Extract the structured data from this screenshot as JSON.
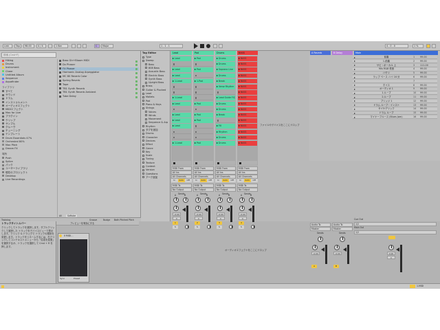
{
  "transport": {
    "link": "Link",
    "tap": "Tap",
    "tempo": "98.00",
    "signature": "4 / 4",
    "quantize": "1 Bar",
    "key": "C",
    "scale": "Major",
    "position": "1 . 1 . 1",
    "loop_end": "4 . 0 . 0",
    "cpu": "1 %"
  },
  "browser": {
    "search_placeholder": "検索 (Cmd+F)",
    "collections": [
      "Hiking",
      "Drums",
      "Instrument",
      "Cheer",
      "Untitled Album",
      "Sequence",
      "Aquafinder"
    ],
    "library_header": "ライブラリ",
    "library": [
      "すべて",
      "サウンド",
      "ドラム",
      "インストゥルメント",
      "オーディオエフェクト",
      "MIDIエフェクト",
      "Max for Live",
      "プラグイン",
      "クリップ",
      "サンプル",
      "グルーヴ",
      "チューニング",
      "テンプレート"
    ],
    "packs": [
      "Drum Essentials 47%",
      "Orchestral 80%",
      "Max Pitch",
      "Dream FX"
    ],
    "places_header": "場所",
    "places": [
      "Push",
      "Splice",
      "パック",
      "ユーザーライブラリ",
      "現在のプロジェクト",
      "Desktop",
      "Live Recordings"
    ],
    "files": [
      "Bass Gtr+Bloom MIDI",
      "Dx Phaser",
      "FX Phaser",
      "Harmonic Analog Arpeggiator",
      "MC 80 Reverb Color",
      "Spring Reverb",
      "Tape",
      "TB1 Synth Reverb",
      "TB1 Synth Reverb Ambient",
      "Tube Delay"
    ],
    "filter_label": "All",
    "filter_value": "Softube",
    "preview_label": "1 項目を選択",
    "preview_hint": "プレビューを有効にする"
  },
  "tag_editor": {
    "title": "Tag Editor",
    "tags": [
      "Type",
      "Sweep",
      "Bass",
      "808 Bass",
      "Acoustic Bass",
      "Electric Bass",
      "Synth Bass",
      "Upright Bass",
      "Brass",
      "Guitar & Plucked",
      "Lead",
      "Mallets",
      "Pad",
      "Piano & Keys",
      "Strings",
      "Voices",
      "Winds",
      "Movement",
      "Sequence & Arp",
      "Rhythm",
      "タグを追加",
      "Drums",
      "Character",
      "Devices",
      "Effect",
      "Genre",
      "Key",
      "Scale",
      "Tuning",
      "Texture",
      "Context",
      "Version",
      "Questions",
      "アーク追加"
    ]
  },
  "tracks": [
    {
      "name": "Lead",
      "color": "#59d9a8",
      "clips": [
        "Lead",
        "",
        "Lead",
        "Lead",
        "1-Lead",
        "",
        "",
        "1-Lead",
        "Lead",
        "",
        "Lead",
        "Lead",
        "Lead",
        "",
        "",
        "1-Lead"
      ],
      "input": "MIDI From",
      "input_src": "All Ins",
      "channel": "All Channels",
      "monitor_in": "In",
      "monitor_auto": "Auto",
      "monitor_off": "Off",
      "output": "MIDI To",
      "output_dst": "No Output",
      "send_label": "Sends",
      "send_a": "A",
      "send_b": "B",
      "vol": "-0.00",
      "pan": "C",
      "num": "1",
      "solo": "S"
    },
    {
      "name": "Pad",
      "color": "#59d9a8",
      "clips": [
        "Pad",
        "",
        "Pad",
        "",
        "1-Pad",
        "",
        "",
        "",
        "Pad",
        "",
        "Pad",
        "Pad",
        "",
        "",
        "",
        "Pad"
      ],
      "input": "MIDI From",
      "input_src": "All Ins",
      "channel": "All Channels",
      "monitor_in": "In",
      "monitor_auto": "Auto",
      "monitor_off": "Off",
      "output": "MIDI To",
      "output_dst": "No Output",
      "send_label": "Sends",
      "send_a": "A",
      "send_b": "B",
      "vol": "-0.00",
      "pan": "C",
      "num": "2",
      "solo": "S"
    },
    {
      "name": "Drums",
      "color": "#59d9a8",
      "clips": [
        "Drums",
        "Drums",
        "Soprano Line",
        "Drums",
        "Break",
        "Verse Rhythm",
        "",
        "Lead Guide FX2",
        "Drums",
        "Drums",
        "Break",
        "",
        "Fill",
        "Rhythm",
        "Drums",
        "Drums"
      ],
      "input": "MIDI From",
      "input_src": "All Ins",
      "channel": "All Channels",
      "monitor_in": "In",
      "monitor_auto": "Auto",
      "monitor_off": "Off",
      "output": "MIDI To",
      "output_dst": "No Output",
      "send_label": "Sends",
      "send_a": "A",
      "send_b": "B",
      "vol": "-0.00",
      "pan": "C",
      "num": "3",
      "solo": "S"
    },
    {
      "name": "BASS",
      "color": "#ea3f3f",
      "clips": [
        "BASS",
        "BASS",
        "BASS",
        "BASS",
        "BASS",
        "BASS",
        "BASS",
        "BASS",
        "BASS",
        "BASS",
        "BASS",
        "BASS",
        "BASS",
        "BASS",
        "BASS",
        "BASS"
      ],
      "input": "MIDI From",
      "input_src": "All Ins",
      "channel": "All Channels",
      "monitor_in": "In",
      "monitor_auto": "Auto",
      "monitor_off": "Off",
      "output": "MIDI To",
      "output_dst": "No Output",
      "send_label": "Sends",
      "send_a": "A",
      "send_b": "B",
      "vol": "-0.00",
      "pan": "C",
      "num": "4",
      "solo": "S"
    }
  ],
  "drop_hint": "ファイルやデバイスをここにドロップ",
  "returns": [
    {
      "name": "A Reverb",
      "color": "#4a6fd9",
      "output": "Audio To",
      "output_dst": "Master",
      "send_label": "Sends",
      "vol": "-0.00",
      "num": "A"
    },
    {
      "name": "B Delay",
      "color": "#b47ed6",
      "output": "Audio To",
      "output_dst": "Master",
      "send_label": "Sends",
      "vol": "-0.00",
      "num": "B"
    }
  ],
  "master": {
    "name": "Main",
    "color": "#3a6dd8",
    "cue_label": "Cue Out",
    "cue_value": "1/2",
    "main_label": "Main Out",
    "main_value": "1/2",
    "vol": "0.00",
    "pan": "C"
  },
  "scenes": [
    {
      "name": "前奏",
      "num": "1",
      "time": "99.00"
    },
    {
      "name": "1-前奏",
      "num": "2",
      "time": "99.00"
    },
    {
      "name": "サビ・ボーカル 上",
      "num": "3",
      "time": "111.00"
    },
    {
      "name": "90s R&B 低音",
      "num": "4",
      "time": "99.00"
    },
    {
      "name": "ハモリ",
      "num": "5",
      "time": "99.00"
    },
    {
      "name": "ラップ ベース ハイ 16 分",
      "num": "6",
      "time": "99.00"
    },
    {
      "name": "",
      "num": "7",
      "time": ""
    },
    {
      "name": "ホイス",
      "num": "8",
      "time": "99.00"
    },
    {
      "name": "オーディオ 1",
      "num": "9",
      "time": "99.00"
    },
    {
      "name": "1-ループ",
      "num": "10",
      "time": "99.00"
    },
    {
      "name": "2-ループ",
      "num": "11",
      "time": "99.00"
    },
    {
      "name": "ブリッジ 1",
      "num": "12",
      "time": "99.00"
    },
    {
      "name": "ドラム ループ・インスト",
      "num": "13",
      "time": "99.00"
    },
    {
      "name": "サイケデリック",
      "num": "14",
      "time": "99.00"
    },
    {
      "name": "ドラム ループ",
      "num": "15",
      "time": "99.00"
    },
    {
      "name": "マイナーブルース (Blues Jam)",
      "num": "16",
      "time": "99.00"
    }
  ],
  "info": {
    "title": "トラックタイトルバー",
    "body": "クリックしてトラックを選択します。ダブルクリックして選択した トラックをデバイスビューで表示します。クリック & ドラッグで トラックの順序を変更します。トラックをリネームするには、右クリックしてコンテキストメニューから「名前を変更」を選択するか、トラックを選択して Cmd + R を押します。"
  },
  "device": {
    "name": "Ⅱ MIDI...",
    "footer_a": "Sync",
    "footer_b": "Preset"
  },
  "chain_hint": "オーディオエフェクトをここにドロップ",
  "groove_bar": {
    "label": "Training",
    "items": [
      "Groove",
      "Nudge",
      "Both Pitched Pitch"
    ]
  },
  "status": {
    "track_label": "1-MIDI",
    "msg": ""
  }
}
